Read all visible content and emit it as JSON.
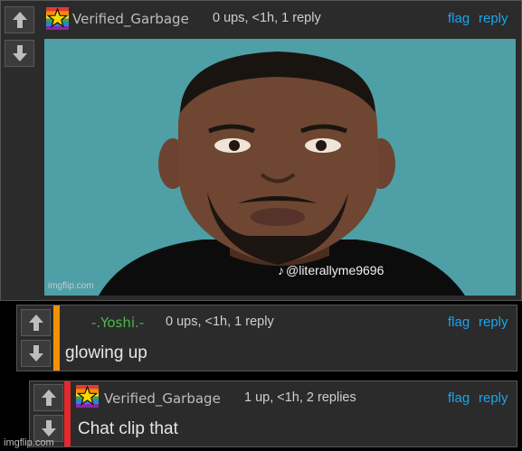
{
  "colors": {
    "bg": "#000000",
    "panel": "#2b2b2c",
    "link": "#1ca4e8",
    "username_default": "#bdbdbd",
    "username_green": "#4cb848",
    "accent_orange": "#f39200",
    "accent_red": "#e5282a"
  },
  "comments": [
    {
      "username": "Verified_Garbage",
      "meta": "0 ups, <1h, 1 reply",
      "flag": "flag",
      "reply": "reply",
      "image": {
        "tiktok_handle": "@literallyme9696",
        "watermark": "imgflip.com"
      }
    },
    {
      "username": "-.Yoshi.-",
      "meta": "0 ups, <1h, 1 reply",
      "flag": "flag",
      "reply": "reply",
      "text": "glowing up"
    },
    {
      "username": "Verified_Garbage",
      "meta": "1 up, <1h, 2 replies",
      "flag": "flag",
      "reply": "reply",
      "text": "Chat clip that"
    }
  ],
  "page_watermark": "imgflip.com",
  "icons": {
    "upvote": "arrow-up-icon",
    "downvote": "arrow-down-icon",
    "flair": "rainbow-star-flair-icon"
  }
}
